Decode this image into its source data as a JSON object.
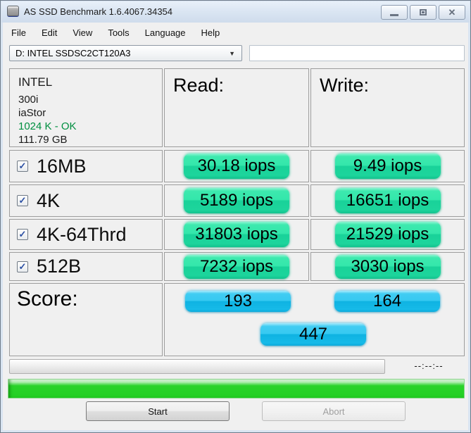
{
  "window": {
    "title": "AS SSD Benchmark 1.6.4067.34354"
  },
  "menu": {
    "items": [
      "File",
      "Edit",
      "View",
      "Tools",
      "Language",
      "Help"
    ]
  },
  "toolbar": {
    "drive_selected": "D: INTEL SSDSC2CT120A3",
    "result_field": ""
  },
  "drive_info": {
    "vendor": "INTEL",
    "firmware": "300i",
    "driver": "iaStor",
    "alignment": "1024 K - OK",
    "capacity": "111.79 GB"
  },
  "headers": {
    "read": "Read:",
    "write": "Write:"
  },
  "rows": [
    {
      "label": "16MB",
      "checked": true,
      "read": "30.18 iops",
      "write": "9.49 iops"
    },
    {
      "label": "4K",
      "checked": true,
      "read": "5189 iops",
      "write": "16651 iops"
    },
    {
      "label": "4K-64Thrd",
      "checked": true,
      "read": "31803 iops",
      "write": "21529 iops"
    },
    {
      "label": "512B",
      "checked": true,
      "read": "7232 iops",
      "write": "3030 iops"
    }
  ],
  "score": {
    "label": "Score:",
    "read": "193",
    "write": "164",
    "total": "447"
  },
  "status": {
    "time": "--:--:--"
  },
  "actions": {
    "start": "Start",
    "abort": "Abort"
  },
  "colors": {
    "result_pill_green": "#1fd49c",
    "score_pill_blue": "#1cbcec",
    "alignment_ok_green": "#008f40",
    "progress_green": "#27d227",
    "titlebar_blue": "#d8e4f2"
  }
}
